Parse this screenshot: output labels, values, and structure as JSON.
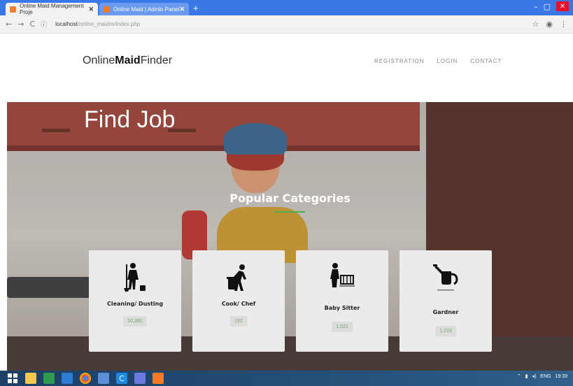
{
  "browser": {
    "tabs": [
      {
        "label": "Online Maid Management Proje"
      },
      {
        "label": "Online Maid | Admin Panel"
      }
    ],
    "url_host": "localhost",
    "url_path": "/online_maidre/index.php"
  },
  "site": {
    "logo_prefix": "Online",
    "logo_bold": "Maid",
    "logo_suffix": "Finder",
    "nav": [
      {
        "label": "REGISTRATION"
      },
      {
        "label": "LOGIN"
      },
      {
        "label": "CONTACT"
      }
    ]
  },
  "hero": {
    "heading": "Find Job",
    "section_title": "Popular Categories"
  },
  "categories": [
    {
      "title": "Cleaning/ Dusting",
      "count": "10,391",
      "icon": "cleaning-icon"
    },
    {
      "title": "Cook/ Chef",
      "count": "192",
      "icon": "cook-icon"
    },
    {
      "title": "Baby Sitter",
      "count": "1,021",
      "icon": "baby-sitter-icon"
    },
    {
      "title": "Gardner",
      "count": "1,219",
      "icon": "watering-can-icon"
    }
  ],
  "taskbar": {
    "lang": "ENG",
    "time": "19:33"
  },
  "colors": {
    "chrome_blue": "#3b78e7",
    "accent_green": "#4caf50",
    "card_bg": "#ebebeb"
  }
}
